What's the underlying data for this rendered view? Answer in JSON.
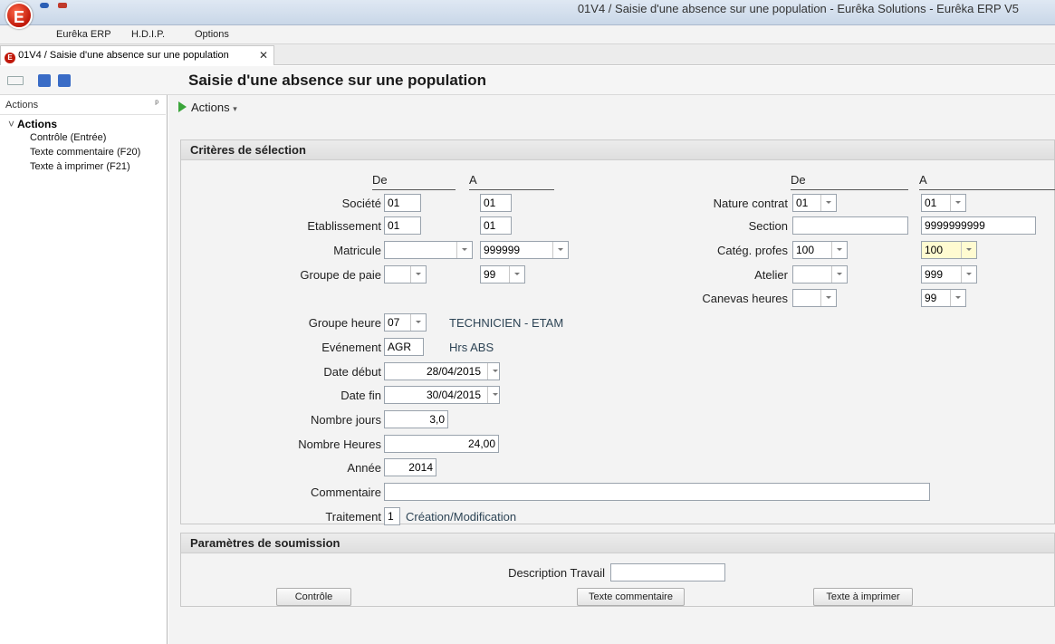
{
  "window": {
    "title": "01V4 / Saisie d'une absence sur une population - Eurêka Solutions - Eurêka ERP V5",
    "app_logo": "E"
  },
  "menu": [
    "Eurêka ERP",
    "H.D.I.P.",
    "Options"
  ],
  "tab": {
    "label": "01V4 / Saisie d'une absence sur une population",
    "logo": "E",
    "close": "✕"
  },
  "page_title": "Saisie d'une absence sur une population",
  "left_pane": {
    "title": "Actions",
    "pin": "ᵖ",
    "group": "Actions",
    "items": [
      "Contrôle (Entrée)",
      "Texte commentaire (F20)",
      "Texte à imprimer (F21)"
    ]
  },
  "actions_button": "Actions",
  "criteria": {
    "title": "Critères de sélection",
    "left_header_from": "De",
    "left_header_to": "A",
    "right_header_from": "De",
    "right_header_to": "A",
    "societe": {
      "label": "Société",
      "from": "01",
      "to": "01"
    },
    "etablissement": {
      "label": "Etablissement",
      "from": "01",
      "to": "01"
    },
    "matricule": {
      "label": "Matricule",
      "from": "",
      "to": "999999"
    },
    "groupe_paie": {
      "label": "Groupe de paie",
      "from": "",
      "to": "99"
    },
    "nature_contrat": {
      "label": "Nature contrat",
      "from": "01",
      "to": "01"
    },
    "section": {
      "label": "Section",
      "from": "",
      "to": "9999999999"
    },
    "categ_profes": {
      "label": "Catég. profes",
      "from": "100",
      "to": "100"
    },
    "atelier": {
      "label": "Atelier",
      "from": "",
      "to": "999"
    },
    "canevas_heures": {
      "label": "Canevas heures",
      "from": "",
      "to": "99"
    },
    "groupe_heure": {
      "label": "Groupe heure",
      "value": "07",
      "desc": "TECHNICIEN - ETAM"
    },
    "evenement": {
      "label": "Evénement",
      "value": "AGR",
      "desc": "Hrs ABS"
    },
    "date_debut": {
      "label": "Date début",
      "value": "28/04/2015"
    },
    "date_fin": {
      "label": "Date fin",
      "value": "30/04/2015"
    },
    "nombre_jours": {
      "label": "Nombre jours",
      "value": "3,0"
    },
    "nombre_heures": {
      "label": "Nombre Heures",
      "value": "24,00"
    },
    "annee": {
      "label": "Année",
      "value": "2014"
    },
    "commentaire": {
      "label": "Commentaire",
      "value": ""
    },
    "traitement": {
      "label": "Traitement",
      "value": "1",
      "desc": "Création/Modification"
    }
  },
  "submission": {
    "title": "Paramètres de soumission",
    "description_label": "Description Travail",
    "description_value": "",
    "buttons": {
      "controle": "Contrôle",
      "commentaire": "Texte commentaire",
      "imprimer": "Texte à imprimer"
    }
  }
}
